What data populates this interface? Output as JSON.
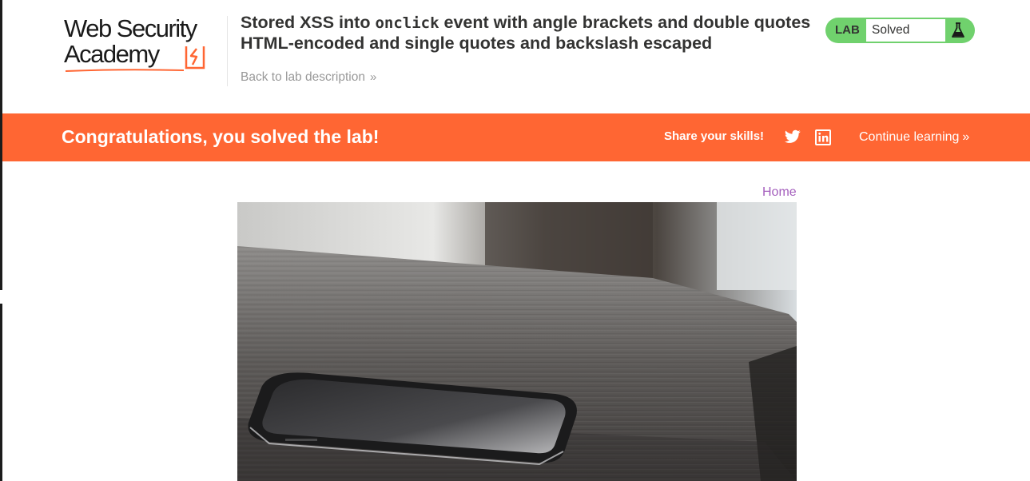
{
  "header": {
    "logo_line1": "Web Security",
    "logo_line2": "Academy",
    "title_prefix": "Stored XSS into ",
    "title_code": "onclick",
    "title_suffix": " event with angle brackets and double quotes HTML-encoded and single quotes and backslash escaped",
    "back_link": "Back to lab description",
    "back_chevron": "»",
    "status_label": "LAB",
    "status_value": "Solved",
    "status_icon": "flask-icon"
  },
  "banner": {
    "message": "Congratulations, you solved the lab!",
    "share_label": "Share your skills!",
    "share_icons": [
      "twitter-icon",
      "linkedin-icon"
    ],
    "continue_label": "Continue learning",
    "continue_chevron": "»"
  },
  "nav": {
    "home_link": "Home"
  },
  "colors": {
    "banner_orange": "#ff6633",
    "status_green": "#70d16d",
    "link_purple": "#a45fbd",
    "muted_gray": "#999999",
    "text_dark": "#333332"
  }
}
